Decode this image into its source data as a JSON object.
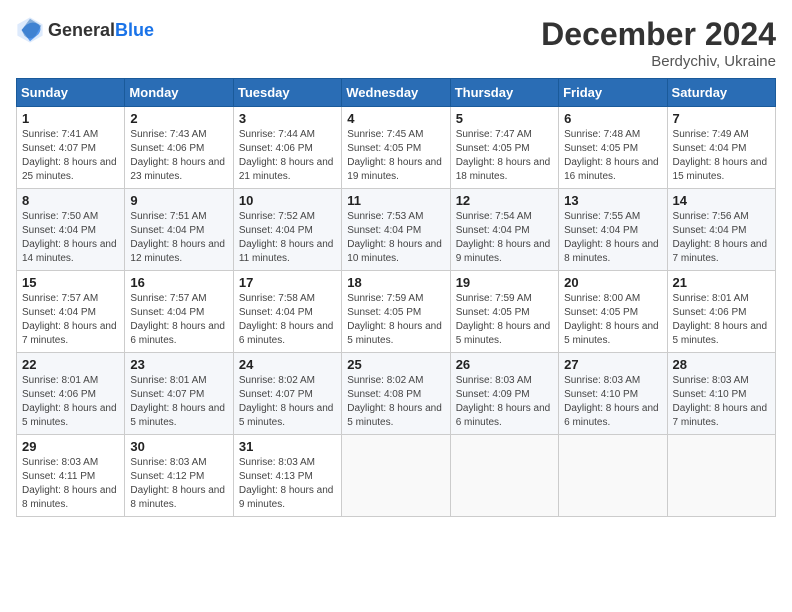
{
  "header": {
    "logo_general": "General",
    "logo_blue": "Blue",
    "month": "December 2024",
    "location": "Berdychiv, Ukraine"
  },
  "days_of_week": [
    "Sunday",
    "Monday",
    "Tuesday",
    "Wednesday",
    "Thursday",
    "Friday",
    "Saturday"
  ],
  "weeks": [
    [
      {
        "day": "1",
        "sunrise": "7:41 AM",
        "sunset": "4:07 PM",
        "daylight": "8 hours and 25 minutes."
      },
      {
        "day": "2",
        "sunrise": "7:43 AM",
        "sunset": "4:06 PM",
        "daylight": "8 hours and 23 minutes."
      },
      {
        "day": "3",
        "sunrise": "7:44 AM",
        "sunset": "4:06 PM",
        "daylight": "8 hours and 21 minutes."
      },
      {
        "day": "4",
        "sunrise": "7:45 AM",
        "sunset": "4:05 PM",
        "daylight": "8 hours and 19 minutes."
      },
      {
        "day": "5",
        "sunrise": "7:47 AM",
        "sunset": "4:05 PM",
        "daylight": "8 hours and 18 minutes."
      },
      {
        "day": "6",
        "sunrise": "7:48 AM",
        "sunset": "4:05 PM",
        "daylight": "8 hours and 16 minutes."
      },
      {
        "day": "7",
        "sunrise": "7:49 AM",
        "sunset": "4:04 PM",
        "daylight": "8 hours and 15 minutes."
      }
    ],
    [
      {
        "day": "8",
        "sunrise": "7:50 AM",
        "sunset": "4:04 PM",
        "daylight": "8 hours and 14 minutes."
      },
      {
        "day": "9",
        "sunrise": "7:51 AM",
        "sunset": "4:04 PM",
        "daylight": "8 hours and 12 minutes."
      },
      {
        "day": "10",
        "sunrise": "7:52 AM",
        "sunset": "4:04 PM",
        "daylight": "8 hours and 11 minutes."
      },
      {
        "day": "11",
        "sunrise": "7:53 AM",
        "sunset": "4:04 PM",
        "daylight": "8 hours and 10 minutes."
      },
      {
        "day": "12",
        "sunrise": "7:54 AM",
        "sunset": "4:04 PM",
        "daylight": "8 hours and 9 minutes."
      },
      {
        "day": "13",
        "sunrise": "7:55 AM",
        "sunset": "4:04 PM",
        "daylight": "8 hours and 8 minutes."
      },
      {
        "day": "14",
        "sunrise": "7:56 AM",
        "sunset": "4:04 PM",
        "daylight": "8 hours and 7 minutes."
      }
    ],
    [
      {
        "day": "15",
        "sunrise": "7:57 AM",
        "sunset": "4:04 PM",
        "daylight": "8 hours and 7 minutes."
      },
      {
        "day": "16",
        "sunrise": "7:57 AM",
        "sunset": "4:04 PM",
        "daylight": "8 hours and 6 minutes."
      },
      {
        "day": "17",
        "sunrise": "7:58 AM",
        "sunset": "4:04 PM",
        "daylight": "8 hours and 6 minutes."
      },
      {
        "day": "18",
        "sunrise": "7:59 AM",
        "sunset": "4:05 PM",
        "daylight": "8 hours and 5 minutes."
      },
      {
        "day": "19",
        "sunrise": "7:59 AM",
        "sunset": "4:05 PM",
        "daylight": "8 hours and 5 minutes."
      },
      {
        "day": "20",
        "sunrise": "8:00 AM",
        "sunset": "4:05 PM",
        "daylight": "8 hours and 5 minutes."
      },
      {
        "day": "21",
        "sunrise": "8:01 AM",
        "sunset": "4:06 PM",
        "daylight": "8 hours and 5 minutes."
      }
    ],
    [
      {
        "day": "22",
        "sunrise": "8:01 AM",
        "sunset": "4:06 PM",
        "daylight": "8 hours and 5 minutes."
      },
      {
        "day": "23",
        "sunrise": "8:01 AM",
        "sunset": "4:07 PM",
        "daylight": "8 hours and 5 minutes."
      },
      {
        "day": "24",
        "sunrise": "8:02 AM",
        "sunset": "4:07 PM",
        "daylight": "8 hours and 5 minutes."
      },
      {
        "day": "25",
        "sunrise": "8:02 AM",
        "sunset": "4:08 PM",
        "daylight": "8 hours and 5 minutes."
      },
      {
        "day": "26",
        "sunrise": "8:03 AM",
        "sunset": "4:09 PM",
        "daylight": "8 hours and 6 minutes."
      },
      {
        "day": "27",
        "sunrise": "8:03 AM",
        "sunset": "4:10 PM",
        "daylight": "8 hours and 6 minutes."
      },
      {
        "day": "28",
        "sunrise": "8:03 AM",
        "sunset": "4:10 PM",
        "daylight": "8 hours and 7 minutes."
      }
    ],
    [
      {
        "day": "29",
        "sunrise": "8:03 AM",
        "sunset": "4:11 PM",
        "daylight": "8 hours and 8 minutes."
      },
      {
        "day": "30",
        "sunrise": "8:03 AM",
        "sunset": "4:12 PM",
        "daylight": "8 hours and 8 minutes."
      },
      {
        "day": "31",
        "sunrise": "8:03 AM",
        "sunset": "4:13 PM",
        "daylight": "8 hours and 9 minutes."
      },
      null,
      null,
      null,
      null
    ]
  ]
}
